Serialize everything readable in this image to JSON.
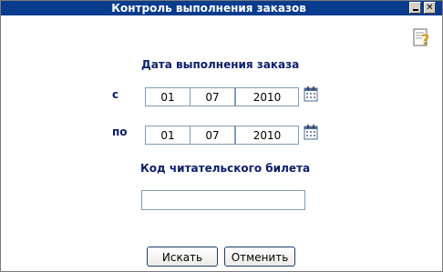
{
  "window": {
    "title": "Контроль выполнения заказов",
    "minimize_glyph": "_",
    "close_glyph": "✕"
  },
  "section_date": {
    "title": "Дата выполнения заказа",
    "from_label": "с",
    "to_label": "по",
    "from": {
      "day": "01",
      "month": "07",
      "year": "2010"
    },
    "to": {
      "day": "01",
      "month": "07",
      "year": "2010"
    }
  },
  "section_ticket": {
    "title": "Код читательского билета",
    "value": ""
  },
  "buttons": {
    "search": "Искать",
    "cancel": "Отменить"
  },
  "colors": {
    "titlebar": "#0a3c8e",
    "label_text": "#0c1d6b",
    "field_border": "#7f9db9"
  },
  "icons": {
    "help": "help-icon",
    "calendar": "calendar-icon",
    "minimize": "minimize-icon",
    "close": "close-icon"
  }
}
